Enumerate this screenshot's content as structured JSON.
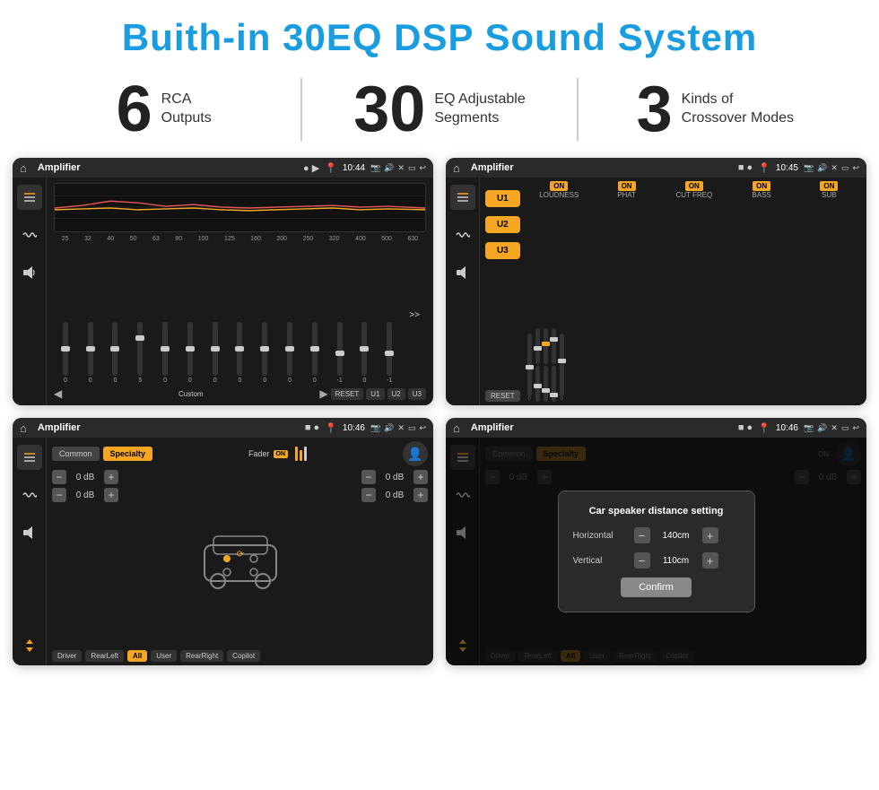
{
  "header": {
    "title": "Buith-in 30EQ DSP Sound System"
  },
  "stats": [
    {
      "number": "6",
      "label": "RCA\nOutputs"
    },
    {
      "number": "30",
      "label": "EQ Adjustable\nSegments"
    },
    {
      "number": "3",
      "label": "Kinds of\nCrossover Modes"
    }
  ],
  "screens": {
    "eq": {
      "status": {
        "title": "Amplifier",
        "time": "10:44"
      },
      "freqs": [
        "25",
        "32",
        "40",
        "50",
        "63",
        "80",
        "100",
        "125",
        "160",
        "200",
        "250",
        "320",
        "400",
        "500",
        "630"
      ],
      "values": [
        "0",
        "0",
        "0",
        "5",
        "0",
        "0",
        "0",
        "0",
        "0",
        "0",
        "0",
        "-1",
        "0",
        "-1"
      ],
      "controls": [
        "Custom",
        "RESET",
        "U1",
        "U2",
        "U3"
      ]
    },
    "crossover": {
      "status": {
        "title": "Amplifier",
        "time": "10:45"
      },
      "uButtons": [
        "U1",
        "U2",
        "U3"
      ],
      "channels": [
        "LOUDNESS",
        "PHAT",
        "CUT FREQ",
        "BASS",
        "SUB"
      ],
      "resetLabel": "RESET"
    },
    "fader": {
      "status": {
        "title": "Amplifier",
        "time": "10:46"
      },
      "tabs": [
        "Common",
        "Specialty"
      ],
      "faderLabel": "Fader",
      "onLabel": "ON",
      "dbValues": [
        "0 dB",
        "0 dB",
        "0 dB",
        "0 dB"
      ],
      "footerBtns": [
        "Driver",
        "RearLeft",
        "All",
        "User",
        "RearRight",
        "Copilot"
      ]
    },
    "distance": {
      "status": {
        "title": "Amplifier",
        "time": "10:46"
      },
      "tabs": [
        "Common",
        "Specialty"
      ],
      "onLabel": "ON",
      "dialog": {
        "title": "Car speaker distance setting",
        "horizontal": {
          "label": "Horizontal",
          "value": "140cm"
        },
        "vertical": {
          "label": "Vertical",
          "value": "110cm"
        },
        "confirmLabel": "Confirm"
      },
      "dbValues": [
        "0 dB",
        "0 dB"
      ],
      "footerBtns": [
        "Driver",
        "RearLeft",
        "All",
        "User",
        "RearRight",
        "Copilot"
      ]
    }
  },
  "icons": {
    "home": "⌂",
    "location": "📍",
    "camera": "📷",
    "volume": "🔊",
    "x": "✕",
    "rect": "▭",
    "back": "↩",
    "eq_icon": "≡",
    "wave": "〜",
    "speaker": "🔉"
  }
}
